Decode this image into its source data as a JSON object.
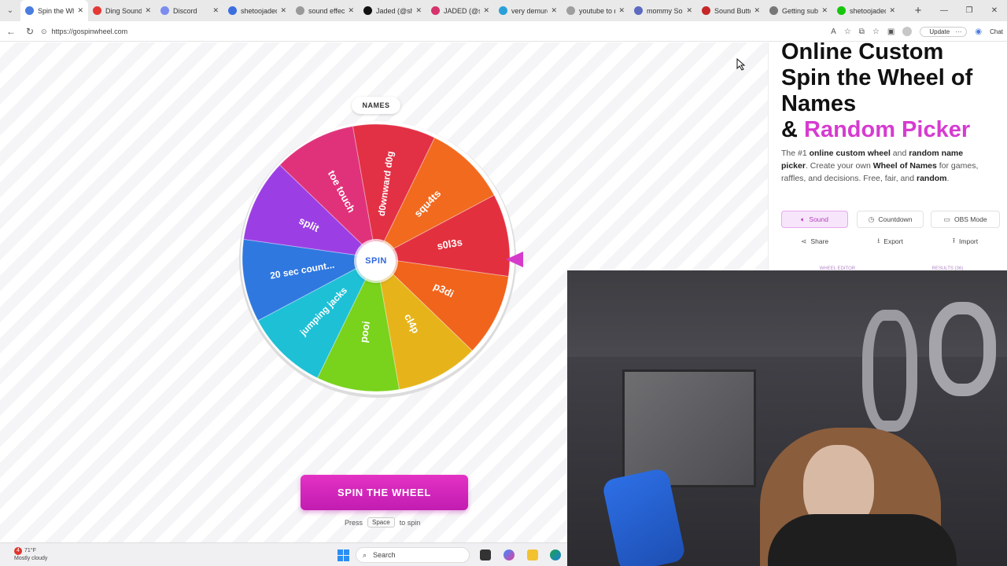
{
  "browser": {
    "tabs": [
      {
        "label": "Spin the Whe",
        "active": true,
        "color": "#4a7de0"
      },
      {
        "label": "Ding Sound E",
        "active": false,
        "color": "#e53935"
      },
      {
        "label": "Discord",
        "active": false,
        "color": "#7b8cf0"
      },
      {
        "label": "shetoojaded",
        "active": false,
        "color": "#3b6fe0"
      },
      {
        "label": "sound effects",
        "active": false,
        "color": "#999999"
      },
      {
        "label": "Jaded (@she",
        "active": false,
        "color": "#111111"
      },
      {
        "label": "JADED (@she",
        "active": false,
        "color": "#d6336c"
      },
      {
        "label": "very demure",
        "active": false,
        "color": "#2aa0d8"
      },
      {
        "label": "youtube to m",
        "active": false,
        "color": "#9e9e9e"
      },
      {
        "label": "mommy Sou",
        "active": false,
        "color": "#5c6bc0"
      },
      {
        "label": "Sound Butto",
        "active": false,
        "color": "#c62828"
      },
      {
        "label": "Getting subs",
        "active": false,
        "color": "#777777"
      },
      {
        "label": "shetoojaded",
        "active": false,
        "color": "#16c60c"
      }
    ],
    "url": "https://gospinwheel.com",
    "update_label": "Update",
    "copilot_label": "Chat"
  },
  "wheel": {
    "names_label": "NAMES",
    "hub_label": "SPIN",
    "segments": [
      {
        "label": "s0l3s",
        "color": "#e3303f"
      },
      {
        "label": "p3di",
        "color": "#f0641c"
      },
      {
        "label": "cl4p",
        "color": "#e6b41a"
      },
      {
        "label": "pooi",
        "color": "#79d21c"
      },
      {
        "label": "jumping jacks",
        "color": "#1ec0d6"
      },
      {
        "label": "20 sec count...",
        "color": "#2f78e0"
      },
      {
        "label": "split",
        "color": "#9b3fe4"
      },
      {
        "label": "toe touch",
        "color": "#e0327a"
      },
      {
        "label": "d0wnward d0g",
        "color": "#e23045"
      },
      {
        "label": "squ4ts",
        "color": "#f26a1e"
      }
    ],
    "spin_button": "SPIN THE WHEEL",
    "hint_press": "Press",
    "hint_key": "Space",
    "hint_suffix": "to spin"
  },
  "panel": {
    "title_line1": "Online Custom",
    "title_line2": "Spin the Wheel of",
    "title_line3": "Names",
    "title_amp": "& ",
    "title_pink": "Random Picker",
    "intro": {
      "p1": "The #1 ",
      "b1": "online custom wheel",
      "p2": " and ",
      "b2": "random name picker",
      "p3": ". Create your own ",
      "b3": "Wheel of Names",
      "p4": " for games, raffles, and decisions. Free, fair, and ",
      "b4": "random",
      "p5": "."
    },
    "buttons": {
      "sound": "Sound",
      "countdown": "Countdown",
      "obs": "OBS Mode",
      "share": "Share",
      "export": "Export",
      "import": "Import"
    },
    "tabs": {
      "editor": "WHEEL EDITOR",
      "results": "RESULTS (36)"
    }
  },
  "taskbar": {
    "weather_temp": "71°F",
    "weather_desc": "Mostly cloudy",
    "weather_badge": "4",
    "search_label": "Search"
  }
}
